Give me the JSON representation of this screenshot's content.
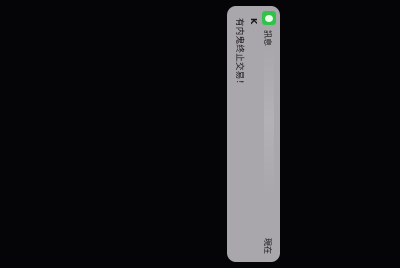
{
  "notification": {
    "app_name": "訊息",
    "app_icon": "messages-app-icon",
    "sender": "K",
    "message": "有内鬼终止交易！",
    "time": "現在",
    "colors": {
      "background": "#050508",
      "banner": "#a9a6ac",
      "app_icon": "#32c24a"
    }
  }
}
